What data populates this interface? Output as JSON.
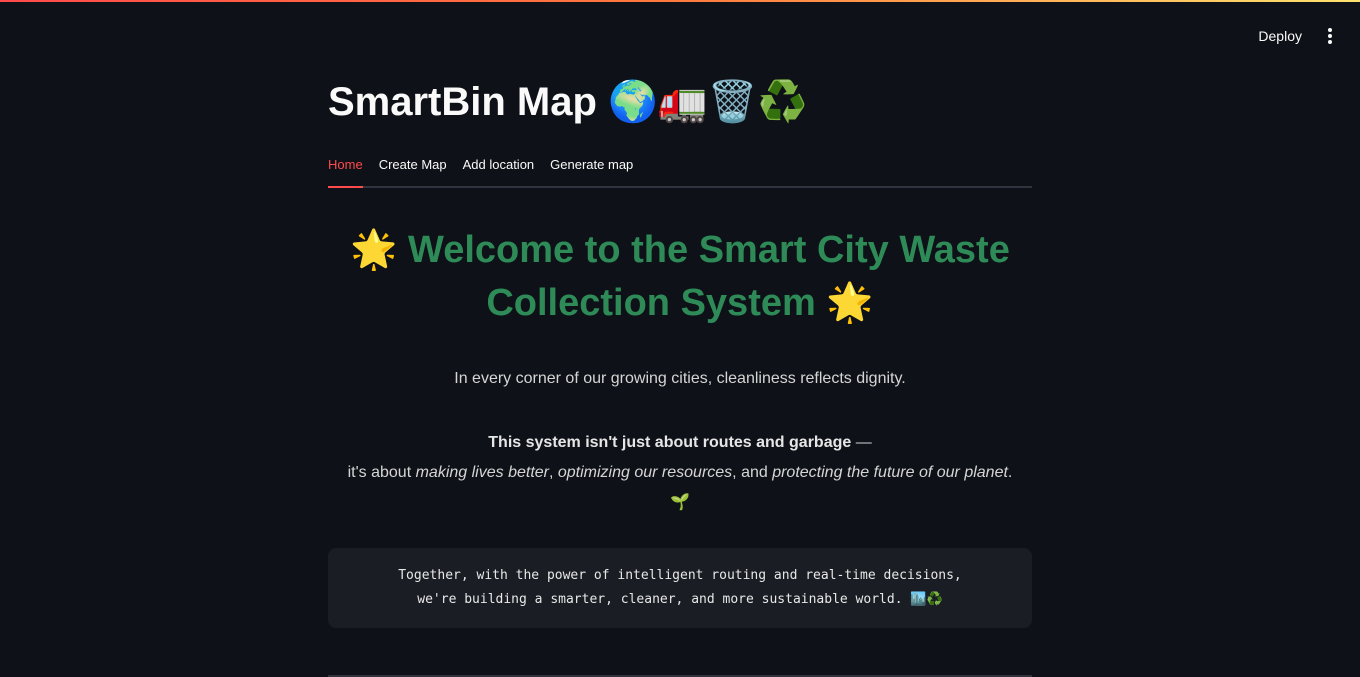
{
  "header": {
    "deploy_label": "Deploy",
    "menu_icon": "kebab-menu-icon",
    "accent_gradient": [
      "#ff4b4b",
      "#ffe36e"
    ]
  },
  "app": {
    "title": "SmartBin Map 🌍🚛🗑️♻️"
  },
  "tabs": [
    {
      "label": "Home",
      "active": true
    },
    {
      "label": "Create Map",
      "active": false
    },
    {
      "label": "Add location",
      "active": false
    },
    {
      "label": "Generate map",
      "active": false
    }
  ],
  "colors": {
    "background": "#0e1117",
    "accent": "#ff4b4b",
    "heading": "#2e8b57",
    "codebox": "#1a1d24"
  },
  "content": {
    "welcome_line1": "🌟 Welcome to the Smart City Waste",
    "welcome_line2": "Collection System 🌟",
    "intro": "In every corner of our growing cities, cleanliness reflects dignity.",
    "mission_bold": "This system isn't just about routes and garbage",
    "mission_dash": " —",
    "mission_prefix": "it's about ",
    "mission_em1": "making lives better",
    "mission_sep1": ", ",
    "mission_em2": "optimizing our resources",
    "mission_sep2": ", and ",
    "mission_em3": "protecting the future of our planet",
    "mission_end": ".",
    "mission_emoji": "🌱",
    "code_line1": "Together, with the power of intelligent routing and real-time decisions,",
    "code_line2": "we're building a smarter, cleaner, and more sustainable world. 🏙️♻️"
  }
}
